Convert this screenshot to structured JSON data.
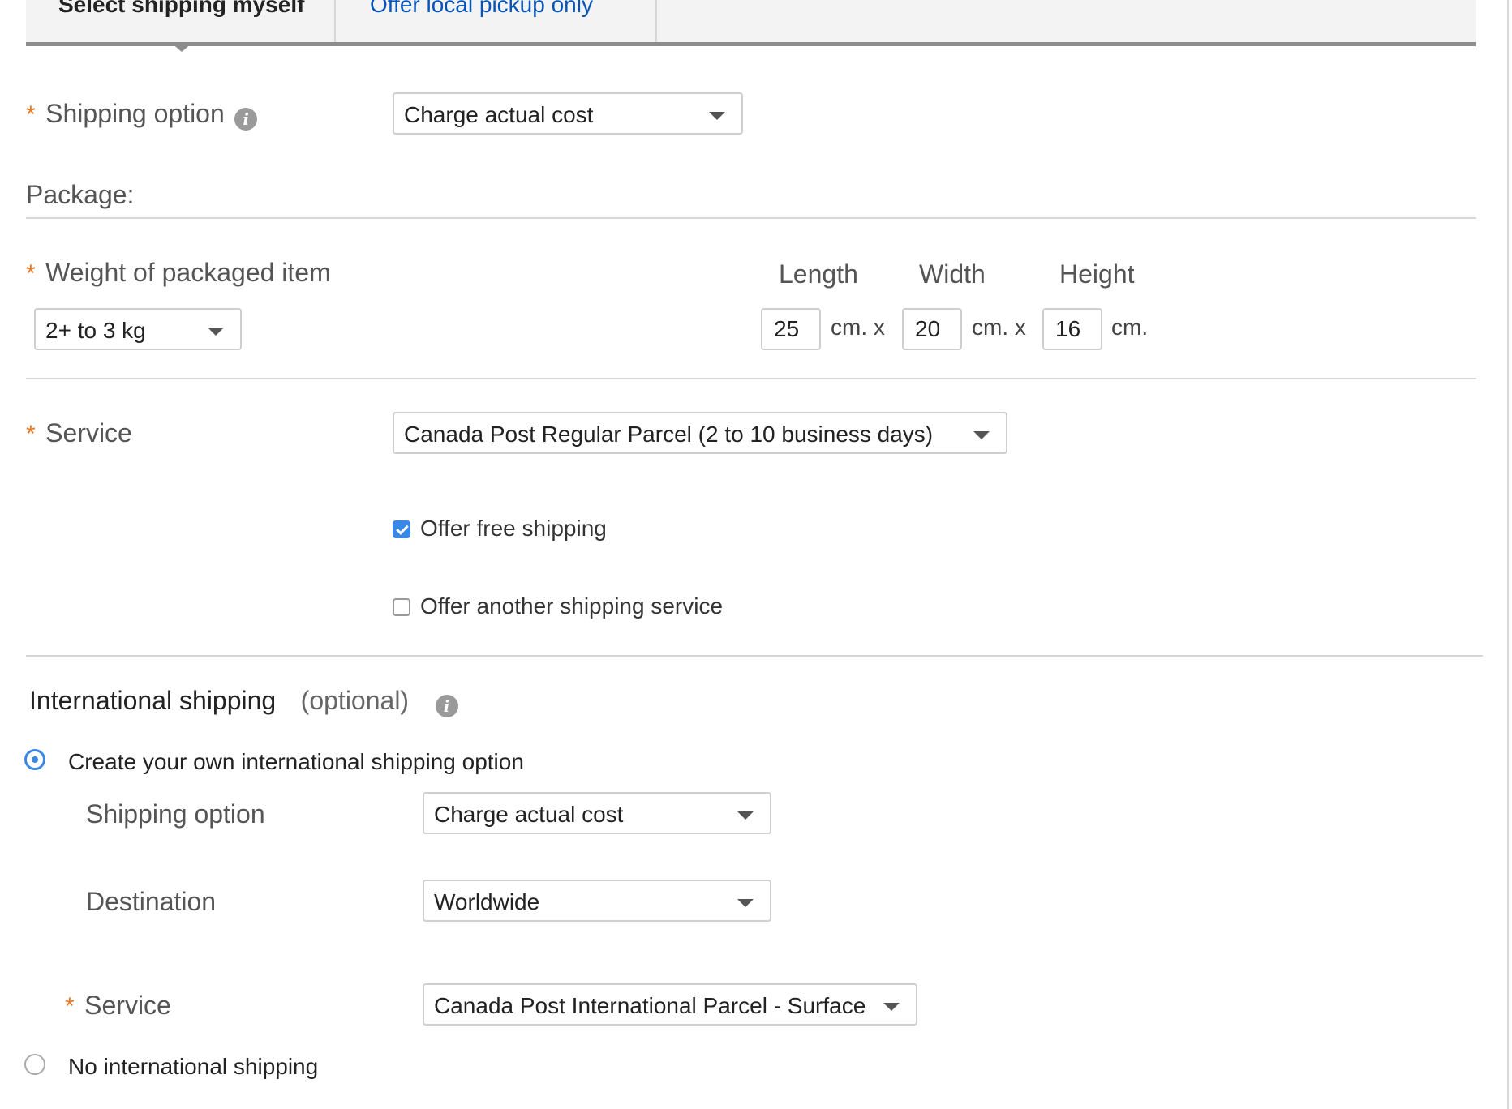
{
  "tabs": {
    "active_label": "Select shipping myself",
    "other_label": "Offer local pickup only"
  },
  "domestic": {
    "shipping_option_label": "Shipping option",
    "shipping_option_value": "Charge actual cost",
    "package_heading": "Package:",
    "weight_label": "Weight of packaged item",
    "weight_value": "2+ to 3 kg",
    "length_label": "Length",
    "width_label": "Width",
    "height_label": "Height",
    "length_value": "25",
    "width_value": "20",
    "height_value": "16",
    "unit_x": "cm. x",
    "unit_end": "cm.",
    "service_label": "Service",
    "service_value": "Canada Post Regular Parcel (2 to 10 business days)",
    "free_shipping_label": "Offer free shipping",
    "free_shipping_checked": true,
    "another_service_label": "Offer another shipping service",
    "another_service_checked": false
  },
  "international": {
    "heading": "International shipping",
    "optional": "(optional)",
    "create_own_label": "Create your own international shipping option",
    "shipping_option_label": "Shipping option",
    "shipping_option_value": "Charge actual cost",
    "destination_label": "Destination",
    "destination_value": "Worldwide",
    "service_label": "Service",
    "service_value": "Canada Post International Parcel - Surface",
    "no_international_label": "No international shipping"
  },
  "asterisk": "*",
  "info_glyph": "i",
  "colors": {
    "accent": "#3a87e6",
    "link": "#0654ba",
    "required": "#e87722"
  }
}
